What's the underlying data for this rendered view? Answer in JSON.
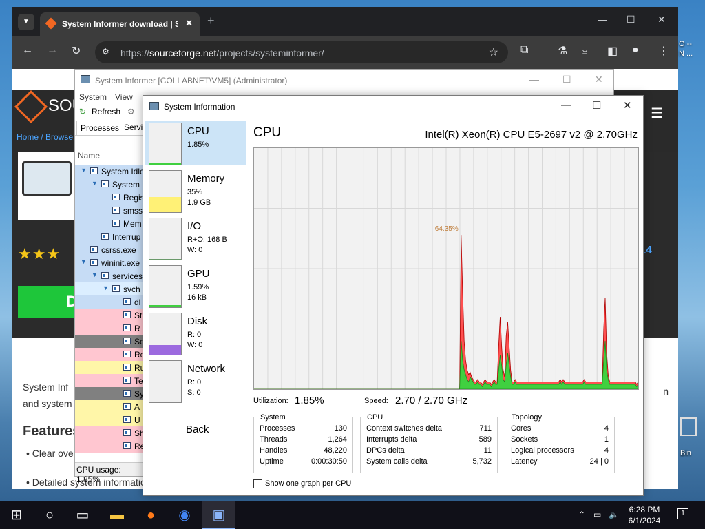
{
  "browser": {
    "tab_title": "System Informer download | S",
    "tab_close": "✕",
    "new_tab": "+",
    "url_host": "sourceforge.net",
    "url_prefix": "https://",
    "url_path": "/projects/systeminformer/"
  },
  "webpage": {
    "brand": "SOU",
    "breadcrumb": "Home / Browse",
    "download_label": "D",
    "right_badge": "5-14",
    "body_text_1": "System Inf",
    "body_text_2": "and system",
    "right_word": "n",
    "features_heading": "Features",
    "bullet_1": "Clear ove",
    "bullet_2": "Detailed system information"
  },
  "si_main": {
    "title": "System Informer [COLLABNET\\VM5] (Administrator)",
    "menu": [
      "System",
      "View"
    ],
    "refresh_label": "Refresh",
    "tabs": [
      "Processes",
      "Servic"
    ],
    "name_header": "Name",
    "processes": [
      {
        "name": "System Idle",
        "indent": 0,
        "expand": true,
        "color": "#c6dcf5"
      },
      {
        "name": "System",
        "indent": 1,
        "expand": true,
        "color": "#c6dcf5"
      },
      {
        "name": "Regis",
        "indent": 2,
        "expand": false,
        "color": "#c6dcf5"
      },
      {
        "name": "smss",
        "indent": 2,
        "expand": false,
        "color": "#c6dcf5"
      },
      {
        "name": "Mem",
        "indent": 2,
        "expand": false,
        "color": "#c6dcf5"
      },
      {
        "name": "Interrup",
        "indent": 1,
        "expand": false,
        "color": "#c6dcf5"
      },
      {
        "name": "csrss.exe",
        "indent": 0,
        "expand": false,
        "color": "#c6dcf5"
      },
      {
        "name": "wininit.exe",
        "indent": 0,
        "expand": true,
        "color": "#c6dcf5"
      },
      {
        "name": "services",
        "indent": 1,
        "expand": true,
        "color": "#c6dcf5"
      },
      {
        "name": "svch",
        "indent": 2,
        "expand": true,
        "color": "#dbeeff"
      },
      {
        "name": "dl",
        "indent": 3,
        "expand": false,
        "color": "#c6dcf5"
      },
      {
        "name": "St",
        "indent": 3,
        "expand": false,
        "color": "#ffc6d0"
      },
      {
        "name": "R",
        "indent": 3,
        "expand": false,
        "color": "#ffc6d0"
      },
      {
        "name": "Se",
        "indent": 3,
        "expand": false,
        "color": "#808080"
      },
      {
        "name": "Re",
        "indent": 3,
        "expand": false,
        "color": "#ffc6d0"
      },
      {
        "name": "Ru",
        "indent": 3,
        "expand": false,
        "color": "#fff6a8"
      },
      {
        "name": "Te",
        "indent": 3,
        "expand": false,
        "color": "#ffc6d0"
      },
      {
        "name": "Sy",
        "indent": 3,
        "expand": false,
        "color": "#808080"
      },
      {
        "name": "A",
        "indent": 3,
        "expand": false,
        "color": "#fff6a8"
      },
      {
        "name": "U",
        "indent": 3,
        "expand": false,
        "color": "#fff6a8"
      },
      {
        "name": "Sh",
        "indent": 3,
        "expand": false,
        "color": "#ffc6d0"
      },
      {
        "name": "Re",
        "indent": 3,
        "expand": false,
        "color": "#ffc6d0"
      }
    ],
    "status": "CPU usage: 1.85%"
  },
  "sysinfo": {
    "title": "System Information",
    "sidebar": [
      {
        "name": "CPU",
        "v1": "1.85%",
        "v2": ""
      },
      {
        "name": "Memory",
        "v1": "35%",
        "v2": "1.9 GB"
      },
      {
        "name": "I/O",
        "v1": "R+O: 168 B",
        "v2": "W: 0"
      },
      {
        "name": "GPU",
        "v1": "1.59%",
        "v2": "16 kB"
      },
      {
        "name": "Disk",
        "v1": "R: 0",
        "v2": "W: 0"
      },
      {
        "name": "Network",
        "v1": "R: 0",
        "v2": "S: 0"
      }
    ],
    "back": "Back",
    "heading": "CPU",
    "cpu_model": "Intel(R) Xeon(R) CPU E5-2697 v2 @ 2.70GHz",
    "utilization_label": "Utilization:",
    "utilization_value": "1.85%",
    "speed_label": "Speed:",
    "speed_value": "2.70 / 2.70 GHz",
    "system_box": {
      "caption": "System",
      "rows": [
        {
          "k": "Processes",
          "v": "130"
        },
        {
          "k": "Threads",
          "v": "1,264"
        },
        {
          "k": "Handles",
          "v": "48,220"
        },
        {
          "k": "Uptime",
          "v": "0:00:30:50"
        }
      ]
    },
    "cpu_box": {
      "caption": "CPU",
      "rows": [
        {
          "k": "Context switches delta",
          "v": "711"
        },
        {
          "k": "Interrupts delta",
          "v": "589"
        },
        {
          "k": "DPCs delta",
          "v": "11"
        },
        {
          "k": "System calls delta",
          "v": "5,732"
        }
      ]
    },
    "topology_box": {
      "caption": "Topology",
      "rows": [
        {
          "k": "Cores",
          "v": "4"
        },
        {
          "k": "Sockets",
          "v": "1"
        },
        {
          "k": "Logical processors",
          "v": "4"
        },
        {
          "k": "Latency",
          "v": "24 | 0"
        }
      ]
    },
    "one_graph_label": "Show one graph per CPU",
    "peak_label": "64.35%"
  },
  "chart_data": {
    "type": "area",
    "title": "CPU",
    "ylim": [
      0,
      100
    ],
    "grid": true,
    "series": [
      {
        "color": "#40d040",
        "values": [
          0,
          0,
          0,
          0,
          0,
          0,
          0,
          0,
          0,
          0,
          0,
          0,
          0,
          0,
          0,
          0,
          0,
          0,
          0,
          0,
          0,
          0,
          0,
          0,
          0,
          0,
          0,
          0,
          0,
          0,
          0,
          0,
          0,
          0,
          0,
          0,
          0,
          0,
          0,
          0,
          0,
          0,
          0,
          0,
          0,
          0,
          0,
          0,
          0,
          0,
          0,
          0,
          0,
          0,
          0,
          0,
          0,
          0,
          0,
          0,
          0,
          0,
          0,
          0,
          0,
          0,
          0,
          0,
          0,
          0,
          0,
          0,
          0,
          0,
          0,
          0,
          0,
          0,
          0,
          0,
          0,
          0,
          0,
          0,
          0,
          0,
          0,
          0,
          0,
          0,
          0,
          0,
          0,
          0,
          0,
          0,
          0,
          0,
          0,
          0,
          0,
          0,
          0,
          0,
          0,
          0,
          0,
          0,
          0,
          0,
          0,
          0,
          0,
          0,
          0,
          0,
          0,
          0,
          0,
          0,
          0,
          0,
          0,
          0,
          0,
          0,
          0,
          0,
          0,
          0,
          0,
          0,
          0,
          0,
          0,
          0,
          0,
          0,
          20,
          12,
          8,
          6,
          4,
          3,
          5,
          4,
          3,
          2,
          2,
          3,
          2,
          2,
          1,
          2,
          3,
          2,
          2,
          2,
          1,
          2,
          3,
          2,
          2,
          8,
          14,
          10,
          4,
          3,
          10,
          15,
          10,
          5,
          2,
          2,
          3,
          2,
          2,
          2,
          2,
          2,
          2,
          2,
          2,
          2,
          2,
          2,
          2,
          2,
          2,
          2,
          2,
          2,
          2,
          2,
          2,
          2,
          2,
          2,
          2,
          2,
          2,
          2,
          2,
          2,
          3,
          2,
          3,
          2,
          2,
          2,
          2,
          2,
          2,
          2,
          2,
          2,
          2,
          2,
          2,
          2,
          3,
          2,
          2,
          2,
          2,
          2,
          2,
          2,
          2,
          2,
          2,
          2,
          2,
          12,
          20,
          8,
          4,
          2,
          2,
          2,
          2,
          2,
          2,
          2,
          2,
          2,
          2,
          2,
          2,
          2,
          2,
          2,
          2,
          2,
          2,
          1,
          2
        ]
      },
      {
        "color": "#ff5050",
        "values": [
          0,
          0,
          0,
          0,
          0,
          0,
          0,
          0,
          0,
          0,
          0,
          0,
          0,
          0,
          0,
          0,
          0,
          0,
          0,
          0,
          0,
          0,
          0,
          0,
          0,
          0,
          0,
          0,
          0,
          0,
          0,
          0,
          0,
          0,
          0,
          0,
          0,
          0,
          0,
          0,
          0,
          0,
          0,
          0,
          0,
          0,
          0,
          0,
          0,
          0,
          0,
          0,
          0,
          0,
          0,
          0,
          0,
          0,
          0,
          0,
          0,
          0,
          0,
          0,
          0,
          0,
          0,
          0,
          0,
          0,
          0,
          0,
          0,
          0,
          0,
          0,
          0,
          0,
          0,
          0,
          0,
          0,
          0,
          0,
          0,
          0,
          0,
          0,
          0,
          0,
          0,
          0,
          0,
          0,
          0,
          0,
          0,
          0,
          0,
          0,
          0,
          0,
          0,
          0,
          0,
          0,
          0,
          0,
          0,
          0,
          0,
          0,
          0,
          0,
          0,
          0,
          0,
          0,
          0,
          0,
          0,
          0,
          0,
          0,
          0,
          0,
          0,
          0,
          0,
          0,
          0,
          0,
          0,
          0,
          0,
          0,
          0,
          0,
          64,
          40,
          20,
          12,
          8,
          6,
          7,
          5,
          4,
          3,
          3,
          4,
          3,
          3,
          2,
          3,
          4,
          3,
          3,
          3,
          2,
          3,
          4,
          3,
          3,
          18,
          30,
          18,
          8,
          5,
          22,
          28,
          18,
          8,
          3,
          3,
          4,
          3,
          3,
          3,
          3,
          3,
          3,
          3,
          3,
          3,
          3,
          3,
          3,
          3,
          3,
          3,
          3,
          3,
          3,
          3,
          3,
          3,
          3,
          3,
          3,
          3,
          3,
          3,
          3,
          3,
          4,
          3,
          4,
          3,
          3,
          3,
          3,
          3,
          3,
          3,
          3,
          3,
          3,
          3,
          3,
          3,
          4,
          3,
          3,
          3,
          3,
          3,
          3,
          3,
          3,
          3,
          3,
          3,
          3,
          25,
          38,
          15,
          6,
          3,
          3,
          3,
          3,
          3,
          3,
          3,
          3,
          3,
          3,
          3,
          3,
          3,
          3,
          3,
          3,
          3,
          3,
          2,
          3
        ]
      }
    ]
  },
  "taskbar": {
    "time": "6:28 PM",
    "date": "6/1/2024",
    "notification_count": "1"
  },
  "desktop": {
    "right_text_1": "O --",
    "right_text_2": "N ...",
    "bin_label": "Bin"
  }
}
